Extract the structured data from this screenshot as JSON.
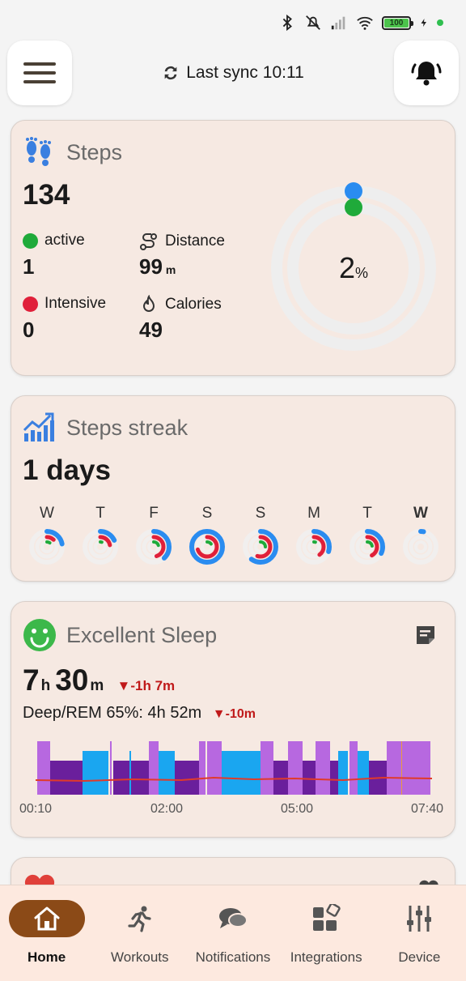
{
  "status": {
    "battery": "100"
  },
  "header": {
    "sync_text": "Last sync 10:11"
  },
  "steps": {
    "title": "Steps",
    "count": "134",
    "active_label": "active",
    "active_value": "1",
    "distance_label": "Distance",
    "distance_value": "99",
    "distance_unit": "m",
    "intensive_label": "Intensive",
    "intensive_value": "0",
    "calories_label": "Calories",
    "calories_value": "49",
    "percent": "2",
    "percent_unit": "%"
  },
  "streak": {
    "title": "Steps streak",
    "value": "1 days",
    "days": [
      {
        "label": "W",
        "outer": 0.22,
        "mid": 0.12,
        "inner": 0.1,
        "today": false
      },
      {
        "label": "T",
        "outer": 0.18,
        "mid": 0.22,
        "inner": 0.05,
        "today": false
      },
      {
        "label": "F",
        "outer": 0.38,
        "mid": 0.45,
        "inner": 0.2,
        "today": false
      },
      {
        "label": "S",
        "outer": 1.0,
        "mid": 0.7,
        "inner": 0.15,
        "today": false
      },
      {
        "label": "S",
        "outer": 0.6,
        "mid": 0.55,
        "inner": 0.25,
        "today": false
      },
      {
        "label": "M",
        "outer": 0.3,
        "mid": 0.4,
        "inner": 0.05,
        "today": false
      },
      {
        "label": "T",
        "outer": 0.32,
        "mid": 0.42,
        "inner": 0.22,
        "today": false
      },
      {
        "label": "W",
        "outer": 0.03,
        "mid": 0.0,
        "inner": 0.0,
        "today": true
      }
    ]
  },
  "sleep": {
    "title": "Excellent Sleep",
    "hours": "7",
    "hours_unit": "h",
    "minutes": "30",
    "minutes_unit": "m",
    "delta": "▼-1h 7m",
    "deep_rem": "Deep/REM 65%: 4h 52m",
    "deep_delta": "▼-10m",
    "axis": [
      "00:10",
      "02:00",
      "05:00",
      "07:40"
    ]
  },
  "nav": {
    "items": [
      {
        "label": "Home",
        "icon": "home-icon"
      },
      {
        "label": "Workouts",
        "icon": "running-icon"
      },
      {
        "label": "Notifications",
        "icon": "chat-icon"
      },
      {
        "label": "Integrations",
        "icon": "integrations-icon"
      },
      {
        "label": "Device",
        "icon": "sliders-icon"
      }
    ]
  },
  "colors": {
    "accent": "#8b4a17",
    "ring_blue": "#2a8cf0",
    "ring_green": "#1faa3a",
    "ring_red": "#e0203a",
    "deep": "#6a1f9c",
    "light": "#b768e0",
    "rem": "#1aa6f0"
  }
}
